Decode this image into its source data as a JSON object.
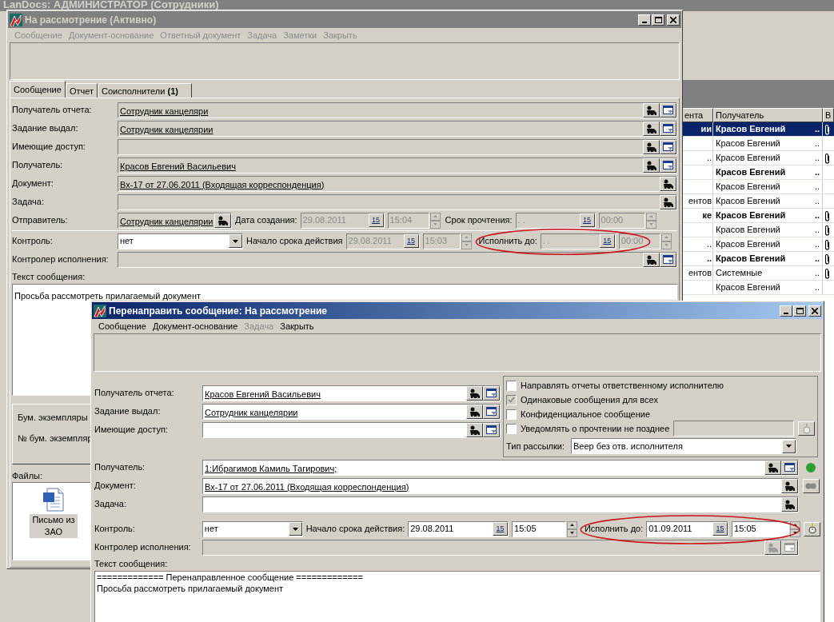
{
  "background_window": {
    "title": "LanDocs: АДМИНИСТРАТОР (Сотрудники)",
    "list": {
      "columns": [
        "ента",
        "Получатель",
        "В"
      ],
      "rows": [
        {
          "column_1": "ии",
          "recipient": "Красов Евгений",
          "more": "..",
          "bold": true,
          "selected": true,
          "attachment": true
        },
        {
          "recipient": "Красов Евгений",
          "more": "..",
          "bold": false,
          "selected": false,
          "attachment": false
        },
        {
          "column_1": "..",
          "recipient": "Красов Евгений",
          "more": "..",
          "bold": false,
          "selected": false,
          "attachment": true
        },
        {
          "recipient": "Красов Евгений",
          "more": "..",
          "bold": true,
          "selected": false,
          "attachment": false
        },
        {
          "recipient": "Красов Евгений",
          "more": "..",
          "bold": false,
          "selected": false,
          "attachment": false
        },
        {
          "column_1": "ентов",
          "recipient": "Красов Евгений",
          "more": "..",
          "bold": false,
          "selected": false,
          "attachment": false
        },
        {
          "column_1": "ке",
          "recipient": "Красов Евгений",
          "more": "..",
          "bold": true,
          "selected": false,
          "attachment": true
        },
        {
          "recipient": "Красов Евгений",
          "more": "..",
          "bold": false,
          "selected": false,
          "attachment": true
        },
        {
          "column_1": "..",
          "recipient": "Красов Евгений",
          "more": "..",
          "bold": false,
          "selected": false,
          "attachment": true
        },
        {
          "column_1": "..",
          "recipient": "Красов Евгений",
          "more": "..",
          "bold": true,
          "selected": false,
          "attachment": true
        },
        {
          "column_1": "ентов",
          "recipient": "Системные",
          "more": "..",
          "bold": false,
          "selected": false,
          "attachment": true
        },
        {
          "recipient": "Красов Евгений",
          "more": "..",
          "bold": false,
          "selected": false,
          "attachment": false
        }
      ]
    }
  },
  "main_window": {
    "title": "На рассмотрение (Активно)",
    "active": false,
    "menu": [
      {
        "label": "Сообщение",
        "disabled": true
      },
      {
        "label": "Документ-основание",
        "disabled": true
      },
      {
        "label": "Ответный документ",
        "disabled": true
      },
      {
        "label": "Задача",
        "disabled": true
      },
      {
        "label": "Заметки",
        "disabled": true
      },
      {
        "label": "Закрыть",
        "disabled": true
      }
    ],
    "tabs": [
      {
        "label": "Сообщение",
        "selected": true
      },
      {
        "label": "Отчет",
        "selected": false
      },
      {
        "label": "Соисполнители **(1)**",
        "selected": false
      }
    ],
    "rows": [
      {
        "label": "Получатель отчета:",
        "value": "Сотрудник канцеляри",
        "kind": "lookup_filter",
        "disabled": true
      },
      {
        "label": "Задание выдал:",
        "value": "Сотрудник канцелярии",
        "kind": "lookup_filter",
        "disabled": true
      },
      {
        "label": "Имеющие доступ:",
        "kind": "lookup_filter",
        "disabled": true
      },
      {
        "label": "Получатель:",
        "value": "Красов Евгений Васильевич",
        "kind": "lookup_filter",
        "disabled": true
      },
      {
        "label": "Документ:",
        "value": "Вх-17 от 27.06.2011 (Входящая корреспонденция)",
        "kind": "lookup",
        "disabled": true
      },
      {
        "label": "Задача:",
        "kind": "lookup",
        "disabled": true
      }
    ],
    "sender": {
      "disabled": true,
      "label": "Отправитель:",
      "value": "Сотрудник канцелярии",
      "created_label": "Дата создания:",
      "created_date": {
        "value": "29.08.2011",
        "button": "15"
      },
      "created_time": "15:04",
      "read_label": "Срок прочтения:",
      "read_date": {
        "value": ". .",
        "button": "15"
      },
      "read_time": "00:00"
    },
    "control": {
      "disabled": true,
      "label": "Контроль:",
      "value": "нет",
      "start_label": "Начало срока действия",
      "start_date": {
        "value": "29.08.2011",
        "button": "15"
      },
      "start_time": "15:03",
      "due_label": "Исполнить до:",
      "due_date": {
        "value": ". .",
        "button": "15"
      },
      "due_time": "00:00",
      "highlighted": true
    },
    "controller": {
      "label": "Контролер исполнения:",
      "kind": "lookup_filter",
      "disabled": true
    },
    "message_label": "Текст сообщения:",
    "message_text": "Просьба рассмотреть прилагаемый документ",
    "paper_copies": {
      "title": "Бум. экземпляры",
      "number_label": "№ бум. экземпляр"
    },
    "files": {
      "label": "Файлы:",
      "items": [
        {
          "name": "Письмо из ЗАО"
        }
      ]
    }
  },
  "forward_window": {
    "title": "Перенаправить сообщение: На рассмотрение",
    "active": true,
    "menu": [
      {
        "label": "Сообщение",
        "disabled": false
      },
      {
        "label": "Документ-основание",
        "disabled": false
      },
      {
        "label": "Задача",
        "disabled": true
      },
      {
        "label": "Закрыть",
        "disabled": false
      }
    ],
    "top_rows": [
      {
        "label": "Получатель отчета:",
        "value": "Красов Евгений Васильевич",
        "kind": "lookup_filter",
        "disabled": false
      },
      {
        "label": "Задание выдал:",
        "value": "Сотрудник канцелярии",
        "kind": "lookup_filter",
        "disabled": false
      },
      {
        "label": "Имеющие доступ:",
        "kind": "lookup_filter",
        "disabled": false
      }
    ],
    "options": [
      {
        "label": "Направлять отчеты ответственному исполнителю",
        "checked": false,
        "disabled": false,
        "kind": "plain"
      },
      {
        "label": "Одинаковые сообщения для всех",
        "checked": true,
        "disabled": true,
        "kind": "plain"
      },
      {
        "label": "Конфиденциальное сообщение",
        "checked": false,
        "disabled": false,
        "kind": "plain"
      },
      {
        "label": "Уведомлять о прочтении не позднее",
        "checked": false,
        "disabled": false,
        "kind": "with_field"
      }
    ],
    "mailing": {
      "label": "Тип рассылки:",
      "value": "Веер без отв. исполнителя"
    },
    "rows": [
      {
        "label": "Получатель:",
        "value": "1:Ибрагимов Камиль Тагирович;",
        "kind": "lookup_filter",
        "disabled": false,
        "color": "#2f9e35"
      },
      {
        "label": "Документ:",
        "value": "Вх-17 от 27.06.2011 (Входящая корреспонденция)",
        "kind": "lookup",
        "disabled": false,
        "link_button": true
      },
      {
        "label": "Задача:",
        "kind": "lookup",
        "disabled": false
      }
    ],
    "control": {
      "disabled": false,
      "label": "Контроль:",
      "value": "нет",
      "start_label": "Начало срока действия:",
      "start_date": {
        "value": "29.08.2011",
        "button": "15"
      },
      "start_time": "15:05",
      "due_label": "Исполнить до:",
      "due_date": {
        "value": "01.09.2011",
        "button": "15"
      },
      "due_time": "15:05",
      "highlighted": true
    },
    "controller": {
      "label": "Контролер исполнения:",
      "kind": "lookup_filter",
      "disabled": true
    },
    "message_label": "Текст сообщения:",
    "message_lines": [
      "============= Перенаправленное сообщение =============",
      "Просьба рассмотреть прилагаемый документ"
    ]
  }
}
